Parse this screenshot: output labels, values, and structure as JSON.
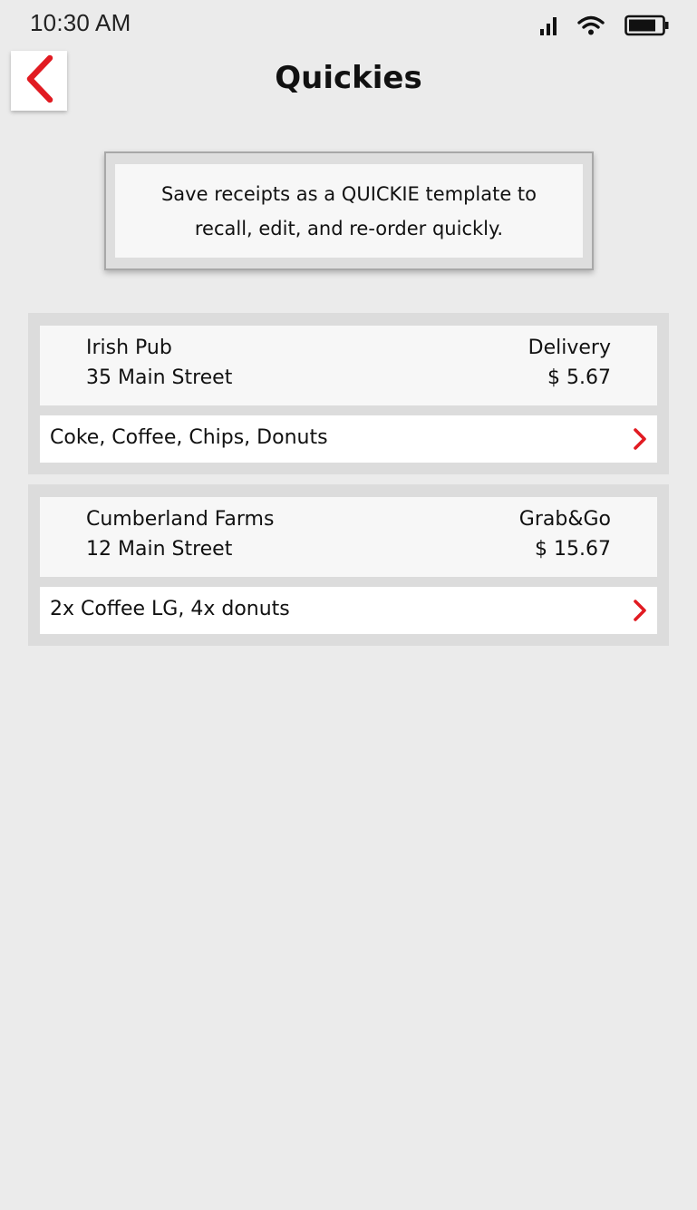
{
  "status_bar": {
    "time": "10:30 AM"
  },
  "header": {
    "title": "Quickies",
    "back_icon": "chevron-left-icon"
  },
  "info": {
    "line1": "Save receipts as a QUICKIE template to",
    "line2": "recall, edit, and re-order quickly."
  },
  "colors": {
    "accent": "#e11b22",
    "background": "#ebebeb"
  },
  "quickies": [
    {
      "store": "Irish Pub",
      "address": "35 Main Street",
      "type": "Delivery",
      "total": "$ 5.67",
      "items": "Coke, Coffee, Chips, Donuts"
    },
    {
      "store": "Cumberland Farms",
      "address": "12 Main Street",
      "type": "Grab&Go",
      "total": "$ 15.67",
      "items": "2x Coffee LG, 4x donuts"
    }
  ]
}
